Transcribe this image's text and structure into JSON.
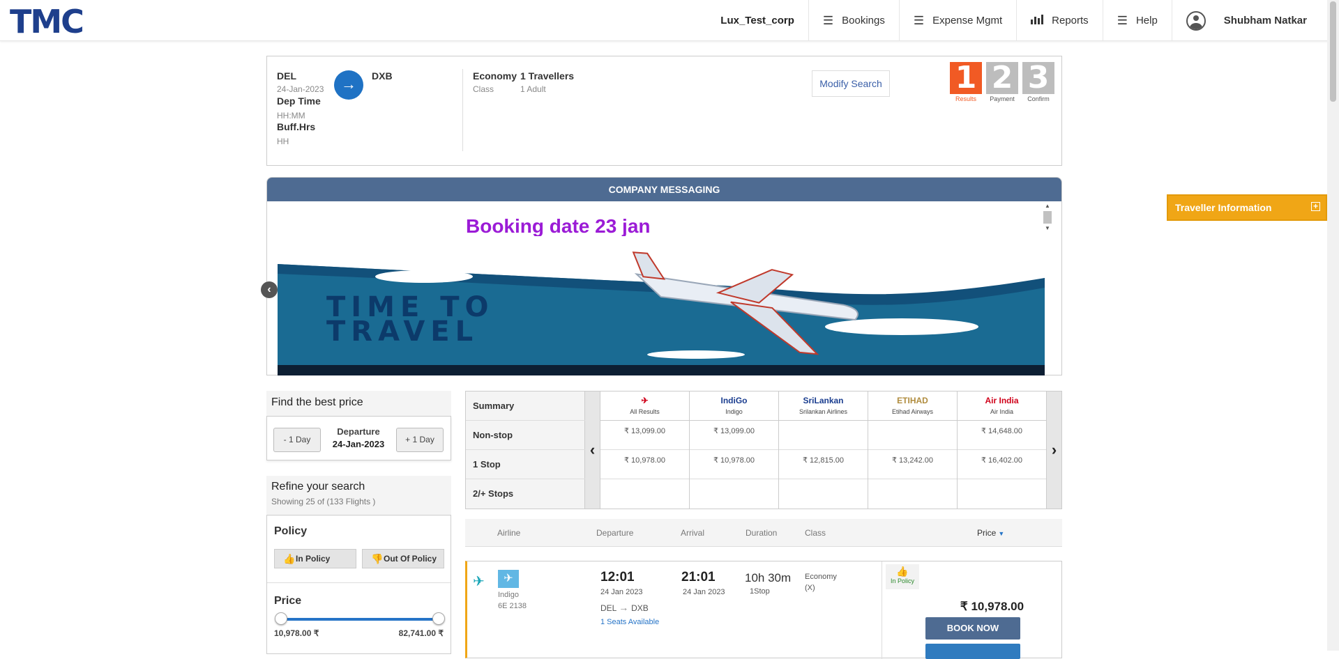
{
  "header": {
    "logo": "TMC",
    "corp": "Lux_Test_corp",
    "nav": [
      {
        "label": "Bookings",
        "icon": "hamburger-icon"
      },
      {
        "label": "Expense Mgmt",
        "icon": "hamburger-icon"
      },
      {
        "label": "Reports",
        "icon": "bar-chart-icon"
      },
      {
        "label": "Help",
        "icon": "hamburger-icon"
      }
    ],
    "user": "Shubham Natkar"
  },
  "search": {
    "from": "DEL",
    "date": "24-Jan-2023",
    "dep_time_label": "Dep Time",
    "dep_time_placeholder": "HH:MM",
    "buff_label": "Buff.Hrs",
    "buff_placeholder": "HH",
    "to": "DXB",
    "class_value": "Economy",
    "class_label": "Class",
    "travellers_value": "1 Travellers",
    "travellers_label": "1 Adult",
    "modify": "Modify Search",
    "steps": [
      {
        "num": "1",
        "label": "Results"
      },
      {
        "num": "2",
        "label": "Payment"
      },
      {
        "num": "3",
        "label": "Confirm"
      }
    ]
  },
  "company_messaging": {
    "header": "COMPANY MESSAGING",
    "title": "Booking date 23 jan",
    "banner_line1": "TIME TO",
    "banner_line2": "TRAVEL"
  },
  "traveller_info": {
    "label": "Traveller Information",
    "toggle": "+"
  },
  "find_best": {
    "title": "Find the best price",
    "prev": "- 1 Day",
    "next": "+ 1 Day",
    "departure_label": "Departure",
    "departure_date": "24-Jan-2023"
  },
  "refine": {
    "title": "Refine your search",
    "showing": "Showing 25 of (133 Flights )",
    "policy_title": "Policy",
    "in_policy": "In Policy",
    "out_policy": "Out Of Policy",
    "price_title": "Price",
    "price_min": "10,978.00 ₹",
    "price_max": "82,741.00 ₹",
    "price_range_fraction": [
      0,
      1
    ]
  },
  "matrix": {
    "row_labels": [
      "Summary",
      "Non-stop",
      "1 Stop",
      "2/+ Stops"
    ],
    "columns": [
      {
        "logo": "✈",
        "logo_color": "#d0021b",
        "name": "All Results",
        "cells": [
          "₹ 13,099.00",
          "₹ 10,978.00",
          ""
        ]
      },
      {
        "logo": "IndiGo",
        "logo_color": "#1a3d8f",
        "name": "Indigo",
        "cells": [
          "₹ 13,099.00",
          "₹ 10,978.00",
          ""
        ]
      },
      {
        "logo": "SriLankan",
        "logo_color": "#1a3d8f",
        "name": "Srilankan Airlines",
        "cells": [
          "",
          "₹ 12,815.00",
          ""
        ]
      },
      {
        "logo": "ETIHAD",
        "logo_color": "#b08c3e",
        "name": "Etihad Airways",
        "cells": [
          "",
          "₹ 13,242.00",
          ""
        ]
      },
      {
        "logo": "Air India",
        "logo_color": "#d0021b",
        "name": "Air India",
        "cells": [
          "₹ 14,648.00",
          "₹ 16,402.00",
          ""
        ]
      }
    ]
  },
  "results_header": {
    "airline": "Airline",
    "departure": "Departure",
    "arrival": "Arrival",
    "duration": "Duration",
    "class": "Class",
    "price": "Price"
  },
  "flight": {
    "airline": "Indigo",
    "flight_no": "6E  2138",
    "dep_time": "12:01",
    "dep_date": "24 Jan 2023",
    "arr_time": "21:01",
    "arr_date": "24 Jan 2023",
    "duration": "10h 30m",
    "stops": "1Stop",
    "route_from": "DEL",
    "route_to": "DXB",
    "seats": "1 Seats Available",
    "class": "Economy",
    "class_code": "(X)",
    "policy": "In Policy",
    "price": "₹ 10,978.00",
    "book": "BOOK NOW"
  }
}
